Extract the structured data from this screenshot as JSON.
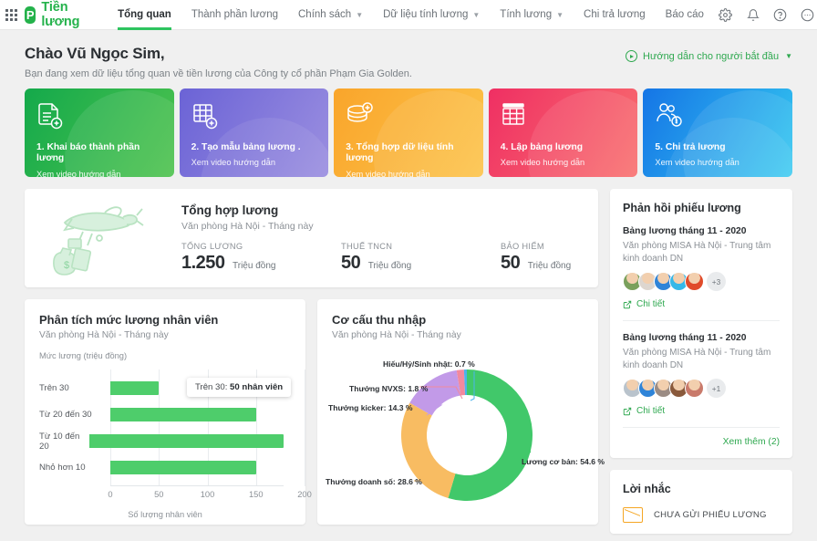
{
  "topbar": {
    "apps_icon": "grid-apps-icon",
    "brand_letter": "P",
    "brand_name": "Tiền lương",
    "nav": [
      {
        "label": "Tổng quan",
        "active": true,
        "caret": false
      },
      {
        "label": "Thành phần lương",
        "active": false,
        "caret": false
      },
      {
        "label": "Chính sách",
        "active": false,
        "caret": true
      },
      {
        "label": "Dữ liệu tính lương",
        "active": false,
        "caret": true
      },
      {
        "label": "Tính lương",
        "active": false,
        "caret": true
      },
      {
        "label": "Chi trả lương",
        "active": false,
        "caret": false
      },
      {
        "label": "Báo cáo",
        "active": false,
        "caret": false
      }
    ],
    "icons": [
      "gear-icon",
      "bell-icon",
      "help-icon",
      "more-icon",
      "avatar"
    ]
  },
  "greeting": {
    "title": "Chào Vũ Ngọc Sim,",
    "subtitle": "Bạn đang xem dữ liệu tổng quan về tiền lương của Công ty cổ phần Phạm Gia Golden.",
    "guide_label": "Hướng dẫn cho người bắt đầu"
  },
  "step_cards": [
    {
      "title": "1. Khai báo thành phần lương",
      "sub": "Xem video hướng dẫn",
      "icon": "document-add-icon",
      "color": "#14a94b"
    },
    {
      "title": "2. Tạo mẫu bảng lương .",
      "sub": "Xem video hướng dẫn",
      "icon": "table-add-icon",
      "color": "#6b63d6"
    },
    {
      "title": "3. Tổng hợp dữ liệu tính lương",
      "sub": "Xem video hướng dẫn",
      "icon": "database-add-icon",
      "color": "#f9a52b"
    },
    {
      "title": "4. Lập bảng lương",
      "sub": "Xem video hướng dẫn",
      "icon": "spreadsheet-icon",
      "color": "#ef2f63"
    },
    {
      "title": "5. Chi trả lương",
      "sub": "Xem video hướng dẫn",
      "icon": "people-money-icon",
      "color": "#1575e6"
    }
  ],
  "summary": {
    "title": "Tổng hợp lương",
    "subtitle": "Văn phòng Hà Nội - Tháng này",
    "stats": [
      {
        "label": "TỔNG LƯƠNG",
        "value": "1.250",
        "unit": "Triệu đồng"
      },
      {
        "label": "THUẾ TNCN",
        "value": "50",
        "unit": "Triệu đồng"
      },
      {
        "label": "BẢO HIỂM",
        "value": "50",
        "unit": "Triệu đồng"
      }
    ]
  },
  "chart_data": [
    {
      "type": "bar",
      "orientation": "horizontal",
      "title": "Phân tích mức lương nhân viên",
      "subtitle": "Văn phòng Hà Nội - Tháng này",
      "ylabel": "Mức lương (triệu đồng)",
      "xlabel": "Số lượng nhân viên",
      "categories": [
        "Trên 30",
        "Từ 20 đến 30",
        "Từ 10 đến 20",
        "Nhỏ hơn 10"
      ],
      "values": [
        50,
        150,
        200,
        150
      ],
      "xlim": [
        0,
        200
      ],
      "xticks": [
        0,
        50,
        100,
        150,
        200
      ],
      "grid": true,
      "bar_color": "#4ecd6b",
      "tooltip": {
        "category": "Trên 30: ",
        "value": "50 nhân viên"
      }
    },
    {
      "type": "pie",
      "variant": "donut",
      "title": "Cơ cấu thu nhập",
      "subtitle": "Văn phòng Hà Nội - Tháng này",
      "labels": [
        "Lương cơ bản",
        "Thưởng doanh số",
        "Thưởng kicker",
        "Thưởng NVXS",
        "Hiếu/Hỷ/Sinh nhật"
      ],
      "values": [
        54.6,
        28.6,
        14.3,
        1.8,
        0.7
      ],
      "unit": "%",
      "colors": [
        "#41c86a",
        "#f8bc62",
        "#c29ae8",
        "#f2899e",
        "#4ab3ec"
      ],
      "annotations": [
        "Lương cơ bản:  54.6 %",
        "Thưởng doanh số:  28.6 %",
        "Thưởng kicker:  14.3 %",
        "Thưởng NVXS:  1.8 %",
        "Hiếu/Hỷ/Sinh nhật: 0.7 %"
      ]
    }
  ],
  "feedback": {
    "title": "Phản hồi phiếu lương",
    "items": [
      {
        "name": "Bảng lương tháng 11 - 2020",
        "dept": "Văn phòng MISA Hà Nội - Trung tâm kinh doanh DN",
        "overflow": "+3",
        "detail_label": "Chi tiết",
        "avatar_colors": [
          "#7aa05c",
          "#d9d2cc",
          "#2f84d8",
          "#35b8e8",
          "#e04b2a"
        ]
      },
      {
        "name": "Bảng lương tháng 11 - 2020",
        "dept": "Văn phòng MISA Hà Nội - Trung tâm kinh doanh DN",
        "overflow": "+1",
        "detail_label": "Chi tiết",
        "avatar_colors": [
          "#b9c3cc",
          "#2f84d8",
          "#9b8c84",
          "#8a5a3c",
          "#c97a6b"
        ]
      }
    ],
    "see_more": "Xem thêm (2)"
  },
  "reminder": {
    "title": "Lời nhắc",
    "item": "CHƯA GỬI PHIẾU LƯƠNG"
  },
  "colors": {
    "brand_green": "#24b24b",
    "accent_green": "#2ea84f",
    "bar_green": "#4ecd6b",
    "page_bg": "#f0f0f0"
  }
}
